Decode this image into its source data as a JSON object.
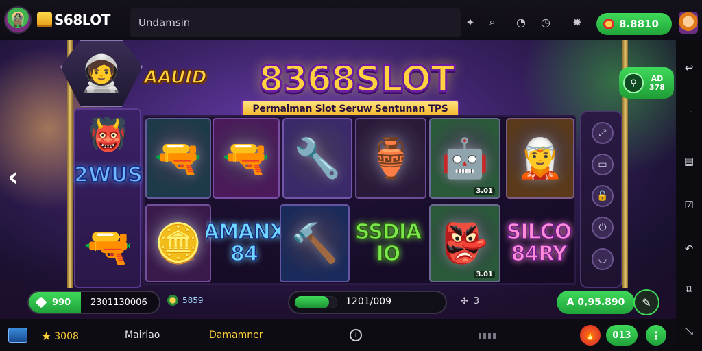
{
  "header": {
    "logo_text": "S68LOT",
    "search_text": "Undamsin",
    "balance": "8.8810"
  },
  "game": {
    "badge_text": "AAUID",
    "title": "8368SLOT",
    "subtitle": "Permaiman Slot Seruw Sentunan TPS",
    "side_label": "2WUS",
    "widget_line1": "AD",
    "widget_line2": "378",
    "reels": [
      {
        "kind": "glyph",
        "glyph": "🔫",
        "bg": "#1c3a4a"
      },
      {
        "kind": "glyph",
        "glyph": "🔫",
        "bg": "#4a1a5a"
      },
      {
        "kind": "glyph",
        "glyph": "🔧",
        "bg": "#3a2a6a"
      },
      {
        "kind": "glyph",
        "glyph": "🏺",
        "bg": "#2a1a3a"
      },
      {
        "kind": "glyph",
        "glyph": "🤖",
        "bg": "#2a5a3a",
        "badge": "3.01"
      },
      {
        "kind": "glyph",
        "glyph": "🧝",
        "bg": "#5a3a1a"
      },
      {
        "kind": "glyph",
        "glyph": "🔫",
        "bg": "#3a2a5a"
      },
      {
        "kind": "glyph",
        "glyph": "🪙",
        "bg": "#3a1a4a"
      },
      {
        "kind": "text",
        "line1": "AMANX",
        "line2": "84",
        "color": "#6fd6ff",
        "stroke": "#1a2a80"
      },
      {
        "kind": "glyph",
        "glyph": "🔨",
        "bg": "#1a2a5a"
      },
      {
        "kind": "text",
        "line1": "SSDIA",
        "line2": "IO",
        "color": "#7ae84a",
        "stroke": "#2a5a10"
      },
      {
        "kind": "glyph",
        "glyph": "👺",
        "bg": "#2a5a3a",
        "badge": "3.01"
      },
      {
        "kind": "text",
        "line1": "SILCO",
        "line2": "84RY",
        "color": "#ff8ad6",
        "stroke": "#6a1a8a"
      }
    ]
  },
  "controls": {
    "credit_value": "990",
    "bet_value": "2301130006",
    "coin_value": "5859",
    "progress_text": "1201/009",
    "progress_fraction": 0.12,
    "multiplier": "3",
    "win_value": "A 0,95.890"
  },
  "bottom": {
    "stars": "3008",
    "main_label": "Mairiao",
    "dem_label": "Damamner",
    "pill_text": "013"
  },
  "colors": {
    "accent_green": "#3fd95a",
    "gold": "#ffd23f",
    "purple": "#3b2266"
  }
}
